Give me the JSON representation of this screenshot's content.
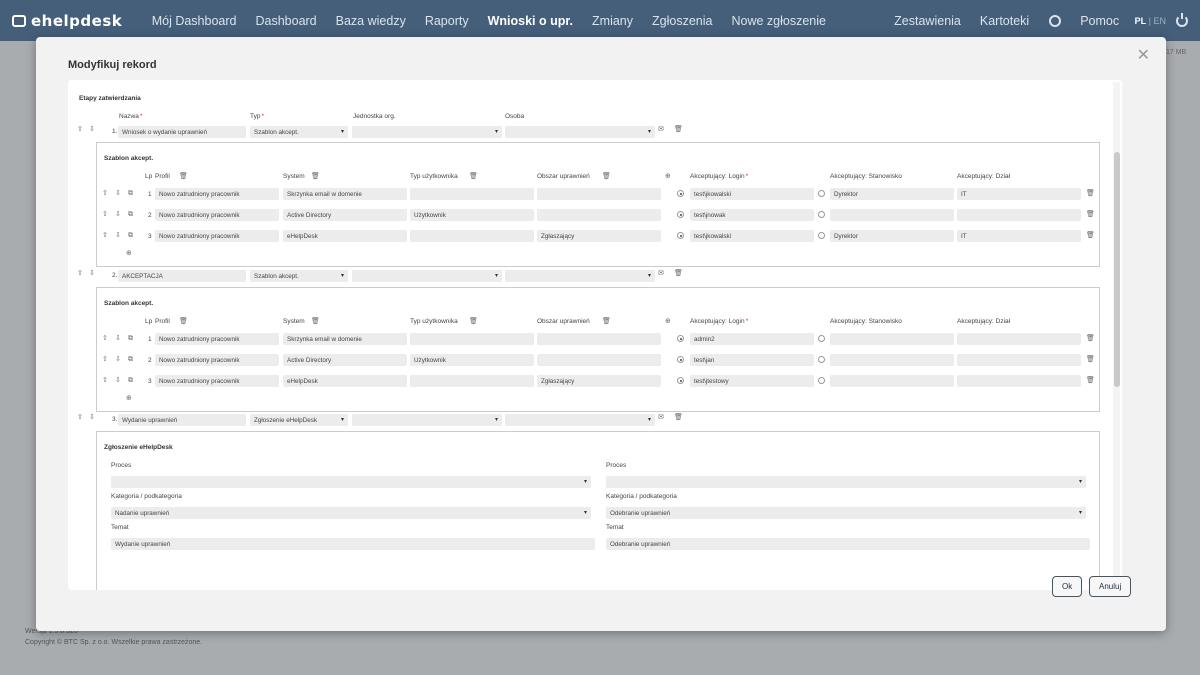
{
  "app": {
    "logo": "ehelpdesk"
  },
  "nav": {
    "items": [
      "Mój Dashboard",
      "Dashboard",
      "Baza wiedzy",
      "Raporty",
      "Wnioski o upr.",
      "Zmiany",
      "Zgłoszenia",
      "Nowe zgłoszenie"
    ],
    "right": [
      "Zestawienia",
      "Kartoteki"
    ],
    "help": "Pomoc",
    "lang_active": "PL",
    "lang_sep": " | ",
    "lang_other": "EN"
  },
  "bg": {
    "size": "17 MB",
    "version": "Wersja 1.9.6.326",
    "copyright": "Copyright © BTC Sp. z o.o. Wszelkie prawa zastrzeżone."
  },
  "modal": {
    "title": "Modyfikuj rekord",
    "section": "Etapy zatwierdzania",
    "headers": {
      "name": "Nazwa",
      "type": "Typ",
      "unit": "Jednostka org.",
      "person": "Osoba"
    },
    "sub_headers": {
      "lp": "Lp",
      "profile": "Profil",
      "system": "System",
      "user_type": "Typ użytkownika",
      "area": "Obszar uprawnień",
      "login": "Akceptujący: Login",
      "position": "Akceptujący: Stanowisko",
      "dept": "Akceptujący: Dział"
    },
    "stages": [
      {
        "num": "1.",
        "name": "Wniosek o wydanie uprawnień",
        "type": "Szablon akcept.",
        "unit": "",
        "person": "",
        "block_title": "Szablon akcept.",
        "rows": [
          {
            "lp": "1",
            "profile": "Nowo zatrudniony pracownik",
            "system": "Skrzynka email w domenie",
            "user_type": "",
            "area": "",
            "login": "test\\jkowalski",
            "position": "Dyrektor",
            "dept": "IT",
            "selected": true
          },
          {
            "lp": "2",
            "profile": "Nowo zatrudniony pracownik",
            "system": "Active Directory",
            "user_type": "Użytkownik",
            "area": "",
            "login": "test\\jnowak",
            "position": "",
            "dept": "",
            "selected": true
          },
          {
            "lp": "3",
            "profile": "Nowo zatrudniony pracownik",
            "system": "eHelpDesk",
            "user_type": "",
            "area": "Zgłaszający",
            "login": "test\\jkowalski",
            "position": "Dyrektor",
            "dept": "IT",
            "selected": true
          }
        ]
      },
      {
        "num": "2.",
        "name": "AKCEPTACJA",
        "type": "Szablon akcept.",
        "unit": "",
        "person": "",
        "block_title": "Szablon akcept.",
        "rows": [
          {
            "lp": "1",
            "profile": "Nowo zatrudniony pracownik",
            "system": "Skrzynka email w domenie",
            "user_type": "",
            "area": "",
            "login": "admin2",
            "position": "",
            "dept": "",
            "selected": true
          },
          {
            "lp": "2",
            "profile": "Nowo zatrudniony pracownik",
            "system": "Active Directory",
            "user_type": "Użytkownik",
            "area": "",
            "login": "test\\jan",
            "position": "",
            "dept": "",
            "selected": true
          },
          {
            "lp": "3",
            "profile": "Nowo zatrudniony pracownik",
            "system": "eHelpDesk",
            "user_type": "",
            "area": "Zgłaszający",
            "login": "test\\jtestowy",
            "position": "",
            "dept": "",
            "selected": true
          }
        ]
      },
      {
        "num": "3.",
        "name": "Wydanie uprawnień",
        "type": "Zgłoszenie eHelpDesk",
        "unit": "",
        "person": "",
        "block_title": "Zgłoszenie eHelpDesk",
        "left": {
          "proces_label": "Proces",
          "proces": "",
          "kat_label": "Kategoria / podkategoria",
          "kat": "Nadanie uprawnień",
          "temat_label": "Temat",
          "temat": "Wydanie uprawnień"
        },
        "right": {
          "proces_label": "Proces",
          "proces": "",
          "kat_label": "Kategoria / podkategoria",
          "kat": "Odebranie uprawnień",
          "temat_label": "Temat",
          "temat": "Odebranie uprawnień"
        }
      }
    ],
    "buttons": {
      "ok": "Ok",
      "cancel": "Anuluj"
    }
  },
  "icons": {
    "up": "arrow-up-icon",
    "down": "arrow-down-icon",
    "copy": "copy-icon",
    "trash": "trash-icon",
    "mail": "mail-icon",
    "add": "add-circle-icon",
    "close": "close-icon",
    "gear": "gear-icon",
    "power": "power-icon",
    "select": "select-caret-icon"
  }
}
